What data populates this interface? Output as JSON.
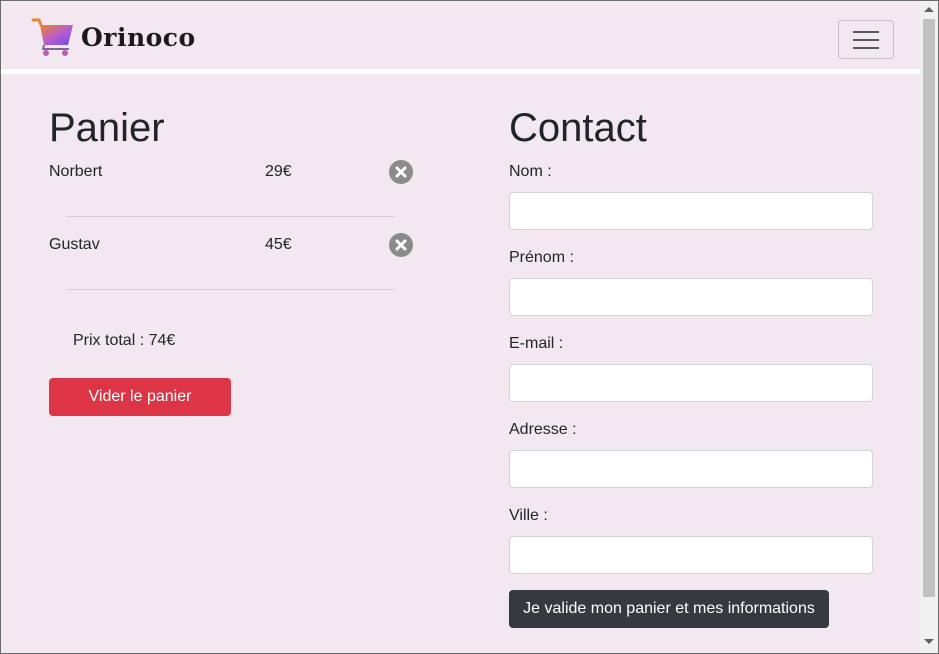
{
  "brand": {
    "name": "Orinoco"
  },
  "navbar": {
    "toggler": "menu-toggler"
  },
  "cart": {
    "title": "Panier",
    "items": [
      {
        "name": "Norbert",
        "price": "29€"
      },
      {
        "name": "Gustav",
        "price": "45€"
      }
    ],
    "total": "Prix total : 74€",
    "clear_label": "Vider le panier"
  },
  "contact": {
    "title": "Contact",
    "fields": [
      {
        "label": "Nom :",
        "value": ""
      },
      {
        "label": "Prénom :",
        "value": ""
      },
      {
        "label": "E-mail :",
        "value": ""
      },
      {
        "label": "Adresse :",
        "value": ""
      },
      {
        "label": "Ville :",
        "value": ""
      }
    ],
    "submit_label": "Je valide mon panier et mes informations"
  },
  "colors": {
    "background": "#f3e8f0",
    "danger": "#dc3545",
    "dark": "#343a40"
  }
}
